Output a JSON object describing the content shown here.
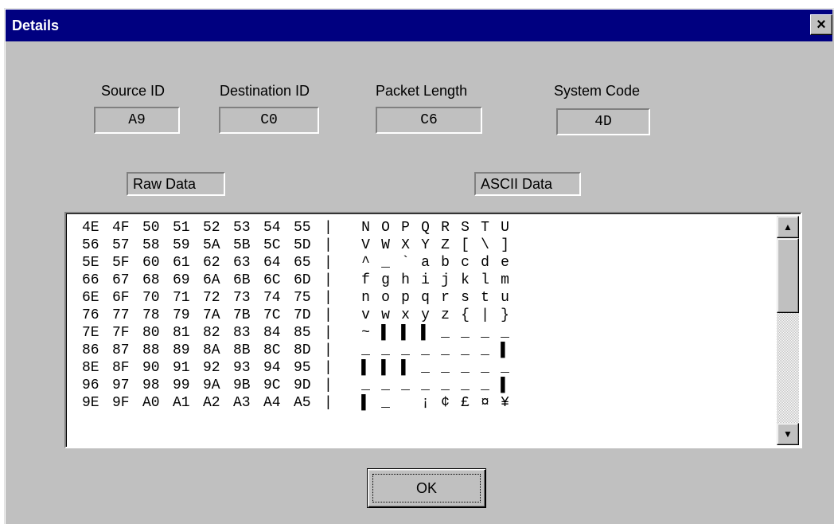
{
  "window": {
    "title": "Details",
    "close_label": "×"
  },
  "fields": {
    "source_id": {
      "label": "Source ID",
      "value": "A9"
    },
    "destination_id": {
      "label": "Destination ID",
      "value": "C0"
    },
    "packet_length": {
      "label": "Packet Length",
      "value": "C6"
    },
    "system_code": {
      "label": "System Code",
      "value": "4D"
    }
  },
  "sections": {
    "raw_data_label": "Raw Data",
    "ascii_data_label": "ASCII Data"
  },
  "data_rows": [
    {
      "hex": [
        "4E",
        "4F",
        "50",
        "51",
        "52",
        "53",
        "54",
        "55"
      ],
      "ascii": [
        "N",
        "O",
        "P",
        "Q",
        "R",
        "S",
        "T",
        "U"
      ]
    },
    {
      "hex": [
        "56",
        "57",
        "58",
        "59",
        "5A",
        "5B",
        "5C",
        "5D"
      ],
      "ascii": [
        "V",
        "W",
        "X",
        "Y",
        "Z",
        "[",
        "\\",
        "]"
      ]
    },
    {
      "hex": [
        "5E",
        "5F",
        "60",
        "61",
        "62",
        "63",
        "64",
        "65"
      ],
      "ascii": [
        "^",
        "_",
        "`",
        "a",
        "b",
        "c",
        "d",
        "e"
      ]
    },
    {
      "hex": [
        "66",
        "67",
        "68",
        "69",
        "6A",
        "6B",
        "6C",
        "6D"
      ],
      "ascii": [
        "f",
        "g",
        "h",
        "i",
        "j",
        "k",
        "l",
        "m"
      ]
    },
    {
      "hex": [
        "6E",
        "6F",
        "70",
        "71",
        "72",
        "73",
        "74",
        "75"
      ],
      "ascii": [
        "n",
        "o",
        "p",
        "q",
        "r",
        "s",
        "t",
        "u"
      ]
    },
    {
      "hex": [
        "76",
        "77",
        "78",
        "79",
        "7A",
        "7B",
        "7C",
        "7D"
      ],
      "ascii": [
        "v",
        "w",
        "x",
        "y",
        "z",
        "{",
        "|",
        "}"
      ]
    },
    {
      "hex": [
        "7E",
        "7F",
        "80",
        "81",
        "82",
        "83",
        "84",
        "85"
      ],
      "ascii": [
        "~",
        "▌",
        "▌",
        "▌",
        "_",
        "_",
        "_",
        "_"
      ]
    },
    {
      "hex": [
        "86",
        "87",
        "88",
        "89",
        "8A",
        "8B",
        "8C",
        "8D"
      ],
      "ascii": [
        "_",
        "_",
        "_",
        "_",
        "_",
        "_",
        "_",
        "▌"
      ]
    },
    {
      "hex": [
        "8E",
        "8F",
        "90",
        "91",
        "92",
        "93",
        "94",
        "95"
      ],
      "ascii": [
        "▌",
        "▌",
        "▌",
        "_",
        "_",
        "_",
        "_",
        "_"
      ]
    },
    {
      "hex": [
        "96",
        "97",
        "98",
        "99",
        "9A",
        "9B",
        "9C",
        "9D"
      ],
      "ascii": [
        "_",
        "_",
        "_",
        "_",
        "_",
        "_",
        "_",
        "▌"
      ]
    },
    {
      "hex": [
        "9E",
        "9F",
        "A0",
        "A1",
        "A2",
        "A3",
        "A4",
        "A5"
      ],
      "ascii": [
        "▌",
        "_",
        " ",
        "¡",
        "¢",
        "£",
        "¤",
        "¥"
      ]
    }
  ],
  "separator": "|",
  "scrollbar": {
    "up_icon": "▲",
    "down_icon": "▼"
  },
  "buttons": {
    "ok_label": "OK"
  }
}
